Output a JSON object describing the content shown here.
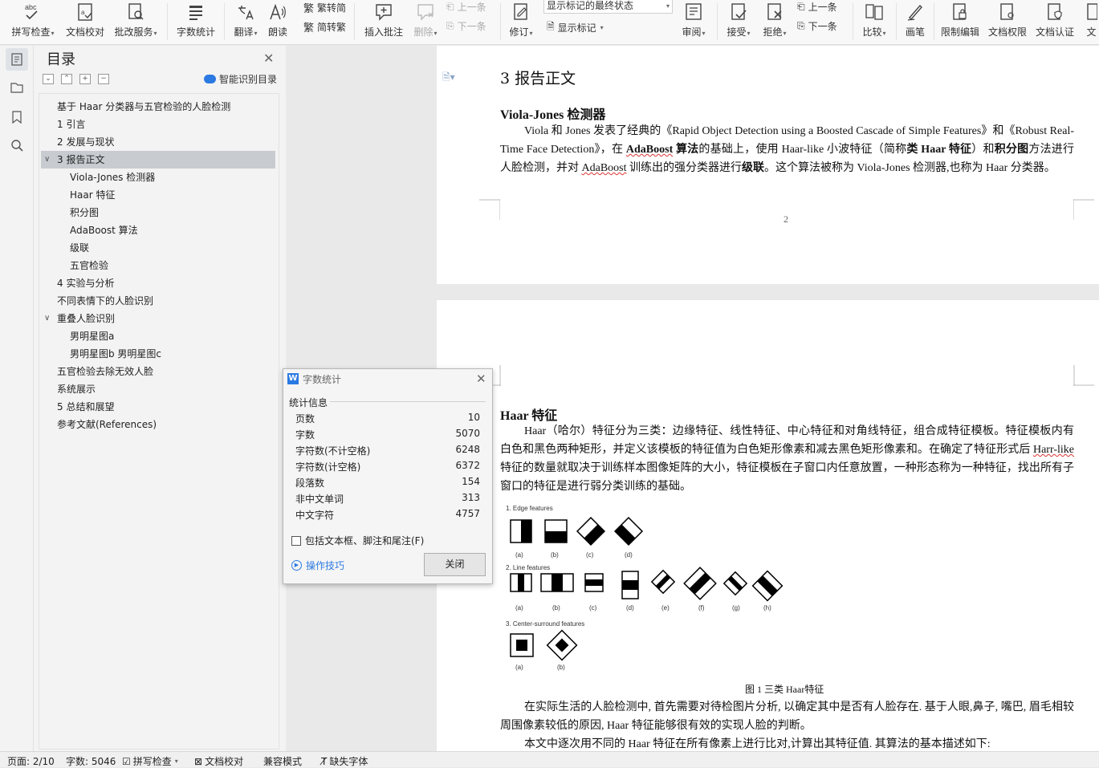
{
  "ribbon": {
    "buttons": [
      {
        "label": "拼写检查",
        "icon": "spellcheck-icon",
        "caret": true
      },
      {
        "label": "文档校对",
        "icon": "proofread-icon",
        "caret": false
      },
      {
        "label": "批改服务",
        "icon": "review-service-icon",
        "caret": true
      },
      {
        "label": "字数统计",
        "icon": "word-count-icon",
        "caret": false
      },
      {
        "label": "翻译",
        "icon": "translate-icon",
        "caret": true
      },
      {
        "label": "朗读",
        "icon": "read-aloud-icon",
        "caret": false
      },
      {
        "label": "插入批注",
        "icon": "insert-comment-icon",
        "caret": false
      },
      {
        "label": "删除",
        "icon": "delete-comment-icon",
        "caret": true
      },
      {
        "label": "修订",
        "icon": "track-changes-icon",
        "caret": true
      },
      {
        "label": "审阅",
        "icon": "review-icon",
        "caret": true
      },
      {
        "label": "接受",
        "icon": "accept-icon",
        "caret": true
      },
      {
        "label": "拒绝",
        "icon": "reject-icon",
        "caret": true
      },
      {
        "label": "比较",
        "icon": "compare-icon",
        "caret": true
      },
      {
        "label": "画笔",
        "icon": "pen-icon",
        "caret": false
      },
      {
        "label": "限制编辑",
        "icon": "restrict-edit-icon",
        "caret": false
      },
      {
        "label": "文档权限",
        "icon": "doc-permission-icon",
        "caret": false
      },
      {
        "label": "文档认证",
        "icon": "doc-auth-icon",
        "caret": false
      },
      {
        "label": "文",
        "icon": "more-icon",
        "caret": false
      }
    ],
    "convert_trad": "繁转简",
    "convert_simp": "简转繁",
    "comment_prev": "上一条",
    "comment_next": "下一条",
    "markup_state": "显示标记的最终状态",
    "show_markup": "显示标记",
    "change_prev": "上一条",
    "change_next": "下一条"
  },
  "toc": {
    "title": "目录",
    "smart": "智能识别目录",
    "items": [
      {
        "text": "基于 Haar 分类器与五官检验的人脸检测",
        "level": 0,
        "arrow": "",
        "selected": false
      },
      {
        "text": "1  引言",
        "level": 0,
        "arrow": "",
        "selected": false
      },
      {
        "text": "2  发展与现状",
        "level": 0,
        "arrow": "",
        "selected": false
      },
      {
        "text": "3 报告正文",
        "level": 0,
        "arrow": "v",
        "selected": true
      },
      {
        "text": "Viola-Jones 检测器",
        "level": 1,
        "arrow": "",
        "selected": false
      },
      {
        "text": "Haar 特征",
        "level": 1,
        "arrow": "",
        "selected": false
      },
      {
        "text": "积分图",
        "level": 1,
        "arrow": "",
        "selected": false
      },
      {
        "text": "AdaBoost 算法",
        "level": 1,
        "arrow": "",
        "selected": false
      },
      {
        "text": "级联",
        "level": 1,
        "arrow": "",
        "selected": false
      },
      {
        "text": "五官检验",
        "level": 1,
        "arrow": "",
        "selected": false
      },
      {
        "text": "4 实验与分析",
        "level": 0,
        "arrow": "",
        "selected": false
      },
      {
        "text": "不同表情下的人脸识别",
        "level": 0,
        "arrow": "",
        "selected": false
      },
      {
        "text": "重叠人脸识别",
        "level": 0,
        "arrow": "v",
        "selected": false
      },
      {
        "text": "男明星图a",
        "level": 1,
        "arrow": "",
        "selected": false
      },
      {
        "text": "男明星图b      男明星图c",
        "level": 1,
        "arrow": "",
        "selected": false
      },
      {
        "text": "五官检验去除无效人脸",
        "level": 0,
        "arrow": "",
        "selected": false
      },
      {
        "text": "系统展示",
        "level": 0,
        "arrow": "",
        "selected": false
      },
      {
        "text": "5  总结和展望",
        "level": 0,
        "arrow": "",
        "selected": false
      },
      {
        "text": "参考文献(References)",
        "level": 0,
        "arrow": "",
        "selected": false
      }
    ]
  },
  "doc": {
    "section_title": "3 报告正文",
    "vj": {
      "title": "Viola-Jones 检测器",
      "p1a": "Viola 和 Jones 发表了经典的《Rapid Object Detection using a Boosted Cascade of Simple Features》和《Robust Real-Time Face Detection》，在 ",
      "p1b": "AdaBoost",
      "p1c": " 算法",
      "p1d": "的基础上，使用 Haar-like 小波特征（简称",
      "p1e": "类 Haar 特征",
      "p1f": "）和",
      "p1g": "积分图",
      "p1h": "方法进行人脸检测，并对 ",
      "p1i": "AdaBoost",
      "p1j": " 训练出的强分类器进行",
      "p1k": "级联",
      "p1l": "。这个算法被称为 Viola-Jones 检测器,也称为 Haar 分类器。"
    },
    "page_number": "2",
    "haar": {
      "title": "Haar 特征",
      "p1a": "Haar（哈尔）特征分为三类：边缘特征、线性特征、中心特征和对角线特征，组合成特征模板。特征模板内有白色和黑色两种矩形，并定义该模板的特征值为白色矩形像素和减去黑色矩形像素和。在确定了特征形式后 ",
      "p1b": "Harr-like",
      "p1c": " 特征的数量就取决于训练样本图像矩阵的大小，特征模板在子窗口内任意放置，一种形态称为一种特征，找出所有子窗口的特征是进行弱分类训练的基础。",
      "fig_edge": "1. Edge features",
      "fig_line": "2. Line features",
      "fig_center": "3. Center-surround features",
      "labels_edge": [
        "(a)",
        "(b)",
        "(c)",
        "(d)"
      ],
      "labels_line": [
        "(a)",
        "(b)",
        "(c)",
        "(d)",
        "(e)",
        "(f)",
        "(g)",
        "(h)"
      ],
      "labels_center": [
        "(a)",
        "(b)"
      ],
      "caption": "图 1 三类 Haar特征",
      "p2": "在实际生活的人脸检测中, 首先需要对待检图片分析, 以确定其中是否有人脸存在. 基于人眼,鼻子, 嘴巴, 眉毛相较周围像素较低的原因, Haar 特征能够很有效的实现人脸的判断。",
      "p3": "本文中逐次用不同的 Haar 特征在所有像素上进行比对,计算出其特征值. 其算法的基本描述如下:"
    }
  },
  "dialog": {
    "title": "字数统计",
    "group": "统计信息",
    "stats": [
      {
        "label": "页数",
        "value": "10"
      },
      {
        "label": "字数",
        "value": "5070"
      },
      {
        "label": "字符数(不计空格)",
        "value": "6248"
      },
      {
        "label": "字符数(计空格)",
        "value": "6372"
      },
      {
        "label": "段落数",
        "value": "154"
      },
      {
        "label": "非中文单词",
        "value": "313"
      },
      {
        "label": "中文字符",
        "value": "4757"
      }
    ],
    "checkbox_label": "包括文本框、脚注和尾注(F)",
    "tips": "操作技巧",
    "close": "关闭"
  },
  "status": {
    "page": "页面: 2/10",
    "words": "字数: 5046",
    "spell": "拼写检查",
    "proof": "文档校对",
    "compat": "兼容模式",
    "missing_font": "缺失字体"
  }
}
